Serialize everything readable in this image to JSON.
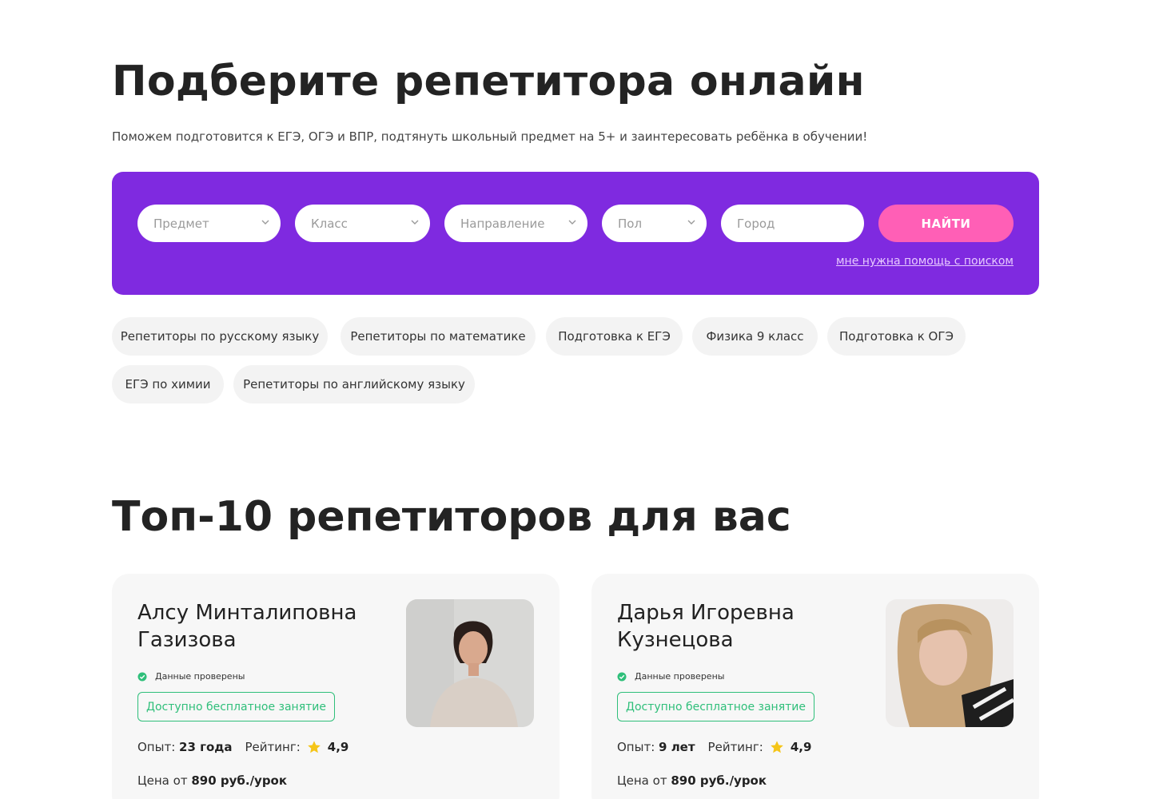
{
  "hero": {
    "title": "Подберите репетитора онлайн",
    "subtitle": "Поможем подготовится к ЕГЭ, ОГЭ и ВПР, подтянуть школьный предмет на 5+ и заинтересовать ребёнка в обучении!"
  },
  "search": {
    "subject_placeholder": "Предмет",
    "grade_placeholder": "Класс",
    "direction_placeholder": "Направление",
    "gender_placeholder": "Пол",
    "city_placeholder": "Город",
    "find_label": "НАЙТИ",
    "help_link": "мне нужна помощь с поиском",
    "panel_color": "#7f2ae0",
    "button_color": "#ff5fb6"
  },
  "chips": [
    "Репетиторы по русскому языку",
    "Репетиторы по математике",
    "Подготовка к ЕГЭ",
    "Физика 9 класс",
    "Подготовка к ОГЭ",
    "ЕГЭ по химии",
    "Репетиторы по английскому языку"
  ],
  "top": {
    "title": "Топ-10 репетиторов для вас",
    "tutors": [
      {
        "name": "Алсу Минталиповна Газизова",
        "verified": "Данные проверены",
        "free_lesson": "Доступно бесплатное занятие",
        "experience_label": "Опыт:",
        "experience": "23 года",
        "rating_label": "Рейтинг:",
        "rating": "4,9",
        "price_label": "Цена от",
        "price": "890 руб./урок"
      },
      {
        "name": "Дарья Игоревна Кузнецова",
        "verified": "Данные проверены",
        "free_lesson": "Доступно бесплатное занятие",
        "experience_label": "Опыт:",
        "experience": "9 лет",
        "rating_label": "Рейтинг:",
        "rating": "4,9",
        "price_label": "Цена от",
        "price": "890 руб./урок"
      }
    ]
  }
}
